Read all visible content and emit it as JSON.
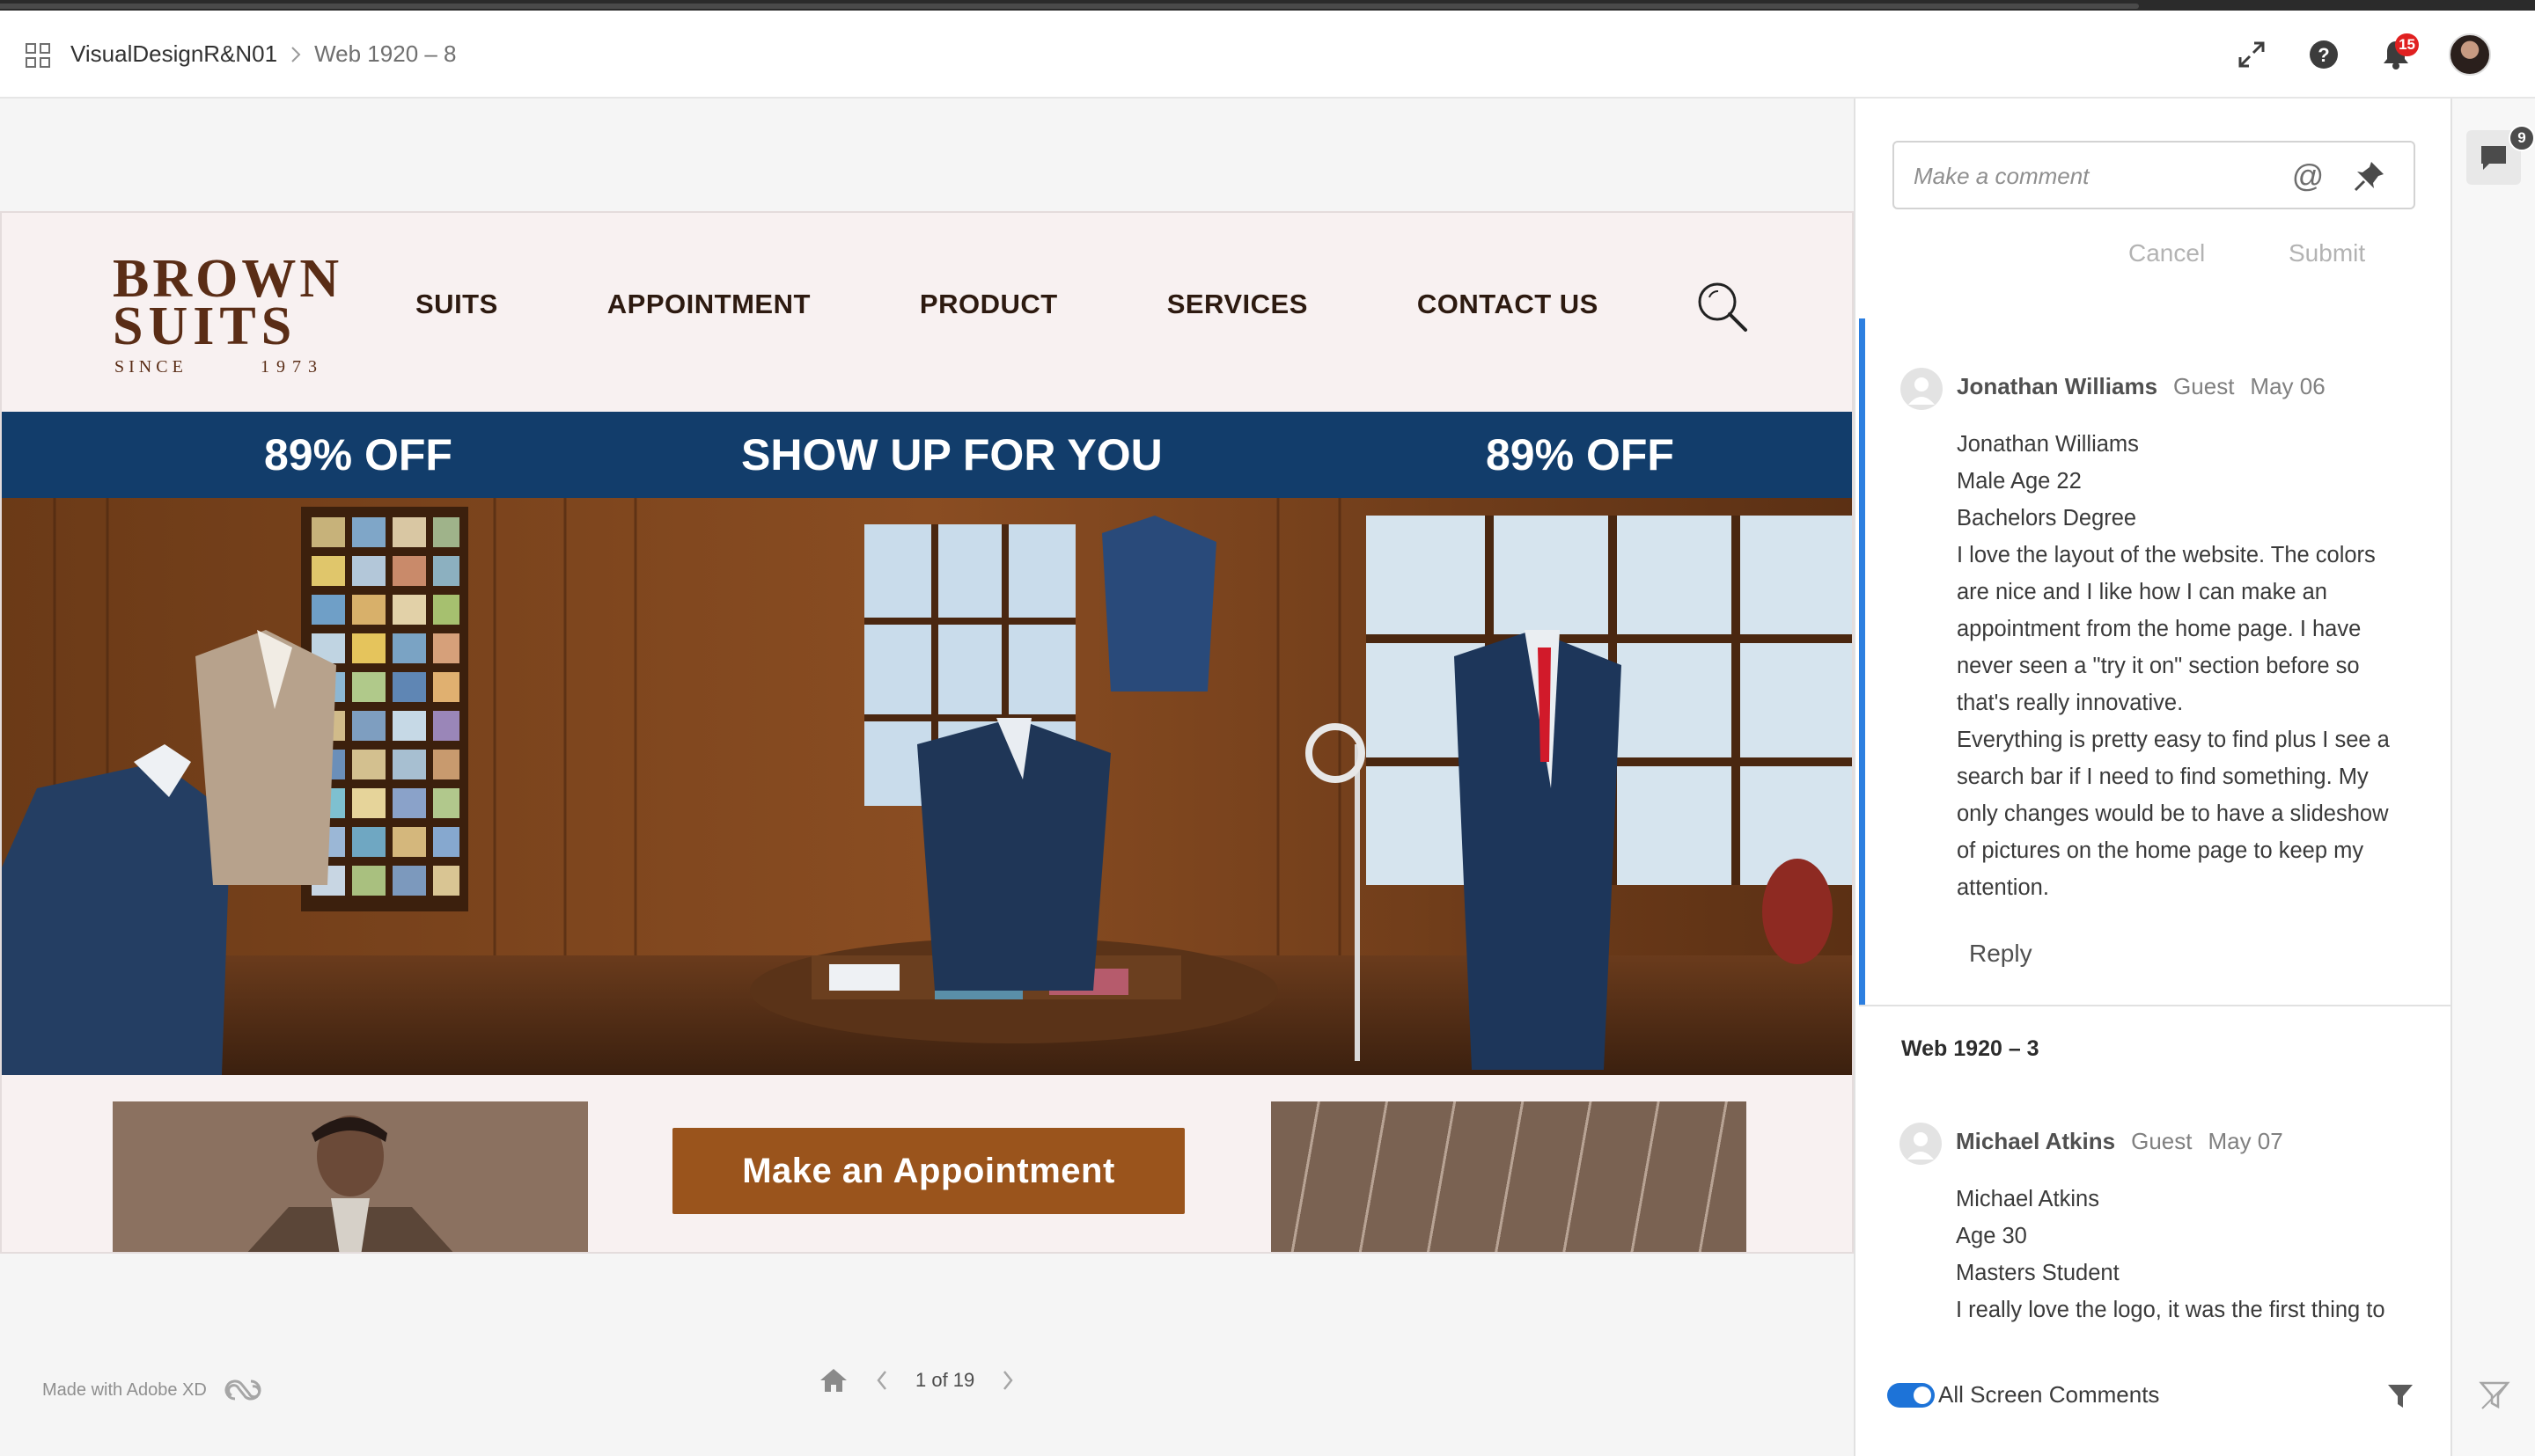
{
  "header": {
    "project": "VisualDesignR&N01",
    "separator": ">",
    "page": "Web 1920 – 8",
    "notification_count": "15"
  },
  "site": {
    "logo": {
      "line1": "BROWN",
      "line2": "SUITS",
      "since": "SINCE",
      "year": "1973"
    },
    "nav": [
      "SUITS",
      "APPOINTMENT",
      "PRODUCT",
      "SERVICES",
      "CONTACT US"
    ],
    "banner": {
      "left": "89% OFF",
      "center": "SHOW UP FOR YOU",
      "right": "89% OFF"
    },
    "appointment_button": "Make an Appointment"
  },
  "footer": {
    "made_with": "Made with Adobe XD",
    "page_indicator": "1 of 19"
  },
  "comments_panel": {
    "placeholder": "Make a comment",
    "cancel": "Cancel",
    "submit": "Submit",
    "thread1": {
      "name": "Jonathan Williams",
      "role": "Guest",
      "date": "May 06",
      "lines": [
        "Jonathan Williams",
        "Male Age 22",
        "Bachelors Degree",
        "I love the layout of the website. The colors",
        "are nice and I like how I can make an",
        "appointment from the home page. I have",
        "never seen a \"try it on\" section before so",
        "that's really innovative.",
        "Everything is pretty easy to find plus I see a",
        "search bar if I need to find something. My",
        "only changes  would be to have a slideshow",
        "of pictures on the home page to keep my",
        "attention."
      ],
      "reply": "Reply"
    },
    "section_title": "Web 1920 – 3",
    "thread2": {
      "name": "Michael Atkins",
      "role": "Guest",
      "date": "May 07",
      "lines": [
        "Michael Atkins",
        "Age 30",
        "Masters Student",
        "I really love the logo, it was the first thing to"
      ]
    },
    "toggle_label": "All Screen Comments",
    "toggle_on": true
  },
  "rail": {
    "comment_count": "9"
  },
  "colors": {
    "accent_blue": "#2d7fe0",
    "banner_blue": "#123d6b",
    "button_brown": "#9a541c",
    "badge_red": "#e02020"
  }
}
